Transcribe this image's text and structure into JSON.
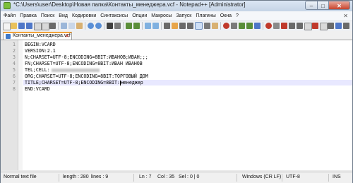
{
  "window": {
    "title": "*C:\\Users\\user\\Desktop\\Новая папка\\Контакты_менеджера.vcf - Notepad++ [Administrator]",
    "controls": {
      "minimize": "–",
      "maximize": "□",
      "close": "✕"
    }
  },
  "menu": {
    "items": [
      "Файл",
      "Правка",
      "Поиск",
      "Вид",
      "Кодировки",
      "Синтаксисы",
      "Опции",
      "Макросы",
      "Запуск",
      "Плагины",
      "Окна",
      "?"
    ],
    "close_glyph": "✕"
  },
  "tab": {
    "label": "Контакты_менеджера.vcf",
    "close_glyph": "✕"
  },
  "editor": {
    "line_numbers": [
      "1",
      "2",
      "3",
      "4",
      "5",
      "6",
      "7",
      "8"
    ],
    "lines": [
      "BEGIN:VCARD",
      "VERSION:2.1",
      "N;CHARSET=UTF-8;ENCODING=8BIT:ИВАНОВ;ИВАН;;;",
      "FN;CHARSET=UTF-8;ENCODING=8BIT:ИВАН ИВАНОВ",
      "TEL;CELL:",
      "ORG;CHARSET=UTF-8;ENCODING=8BIT:ТОРГОВЫЙ ДОМ",
      "TITLE;CHARSET=UTF-8;ENCODING=8BIT:",
      "END:VCARD"
    ],
    "line7_after_caret": "менеджер"
  },
  "status": {
    "file_type": "Normal text file",
    "length": "length : 280",
    "lines": "lines : 9",
    "ln": "Ln : 7",
    "col": "Col : 35",
    "sel": "Sel : 0 | 0",
    "eol": "Windows (CR LF)",
    "encoding": "UTF-8",
    "mode": "INS"
  }
}
